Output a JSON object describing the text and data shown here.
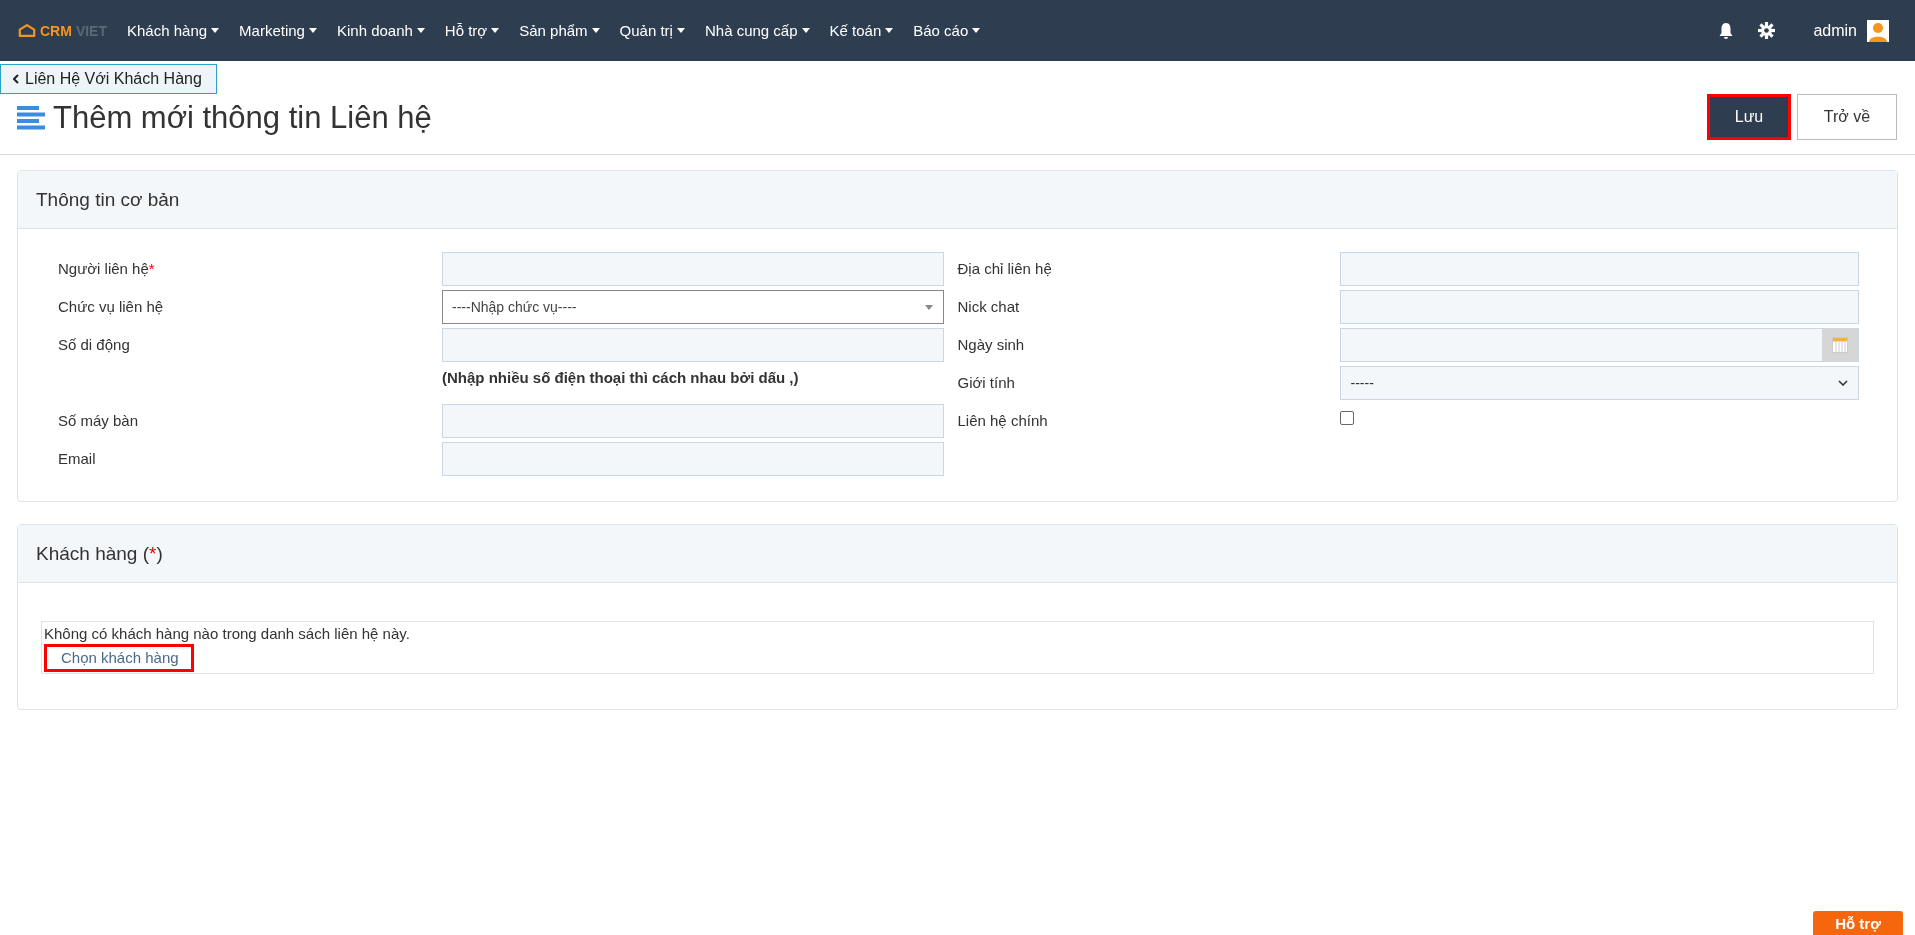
{
  "navbar": {
    "logo": {
      "primary": "CRM",
      "secondary": "VIET"
    },
    "menu": [
      {
        "label": "Khách hàng"
      },
      {
        "label": "Marketing"
      },
      {
        "label": "Kinh doanh"
      },
      {
        "label": "Hỗ trợ"
      },
      {
        "label": "Sản phẩm"
      },
      {
        "label": "Quản trị"
      },
      {
        "label": "Nhà cung cấp"
      },
      {
        "label": "Kế toán"
      },
      {
        "label": "Báo cáo"
      }
    ],
    "user": "admin"
  },
  "breadcrumb": "Liên Hệ Với Khách Hàng",
  "page_title": "Thêm mới thông tin Liên hệ",
  "actions": [
    {
      "label": "Lưu",
      "kind": "primary",
      "highlighted": true
    },
    {
      "label": "Trở về",
      "kind": "default",
      "highlighted": false
    }
  ],
  "basic_info": {
    "title": "Thông tin cơ bản",
    "left_fields": [
      {
        "label": "Người liên hệ",
        "required": true,
        "kind": "text"
      },
      {
        "label": "Chức vụ liên hệ",
        "required": false,
        "kind": "combo",
        "value": "----Nhập chức vụ----"
      },
      {
        "label": "Số di động",
        "required": false,
        "kind": "text",
        "hint": "(Nhập nhiều số điện thoại thì cách nhau bởi dấu ,)"
      },
      {
        "label": "Số máy bàn",
        "required": false,
        "kind": "text"
      },
      {
        "label": "Email",
        "required": false,
        "kind": "text"
      }
    ],
    "right_fields": [
      {
        "label": "Địa chỉ liên hệ",
        "kind": "text"
      },
      {
        "label": "Nick chat",
        "kind": "text"
      },
      {
        "label": "Ngày sinh",
        "kind": "date"
      },
      {
        "label": "Giới tính",
        "kind": "select",
        "value": "-----"
      },
      {
        "label": "Liên hệ chính",
        "kind": "checkbox",
        "checked": false
      }
    ]
  },
  "customers": {
    "title": "Khách hàng (",
    "required_mark": "*",
    "title_end": ")",
    "empty_message": "Không có khách hàng nào trong danh sách liên hệ này.",
    "choose_link": {
      "label": "Chọn khách hàng",
      "highlighted": true
    }
  },
  "help_button": "Hỗ trợ"
}
